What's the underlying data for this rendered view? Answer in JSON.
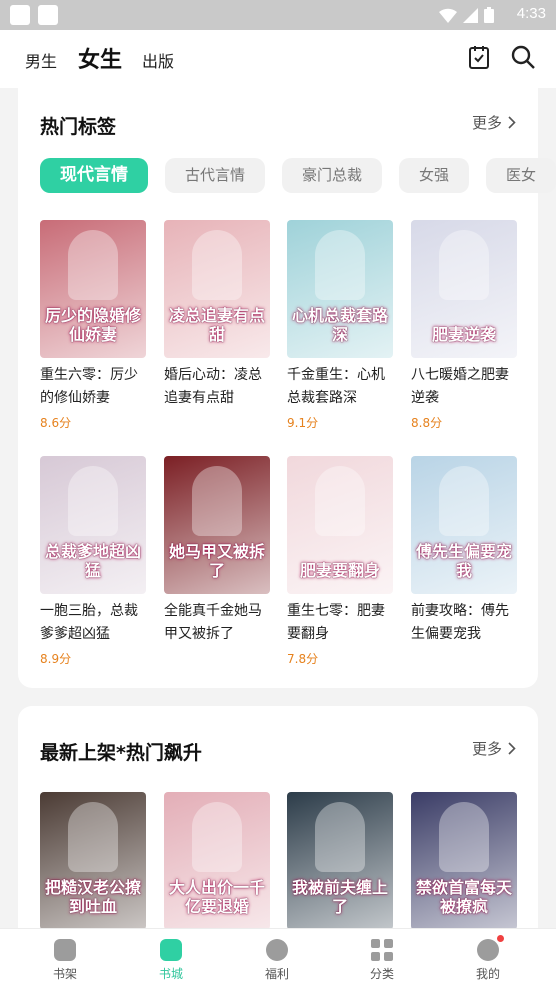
{
  "status_bar": {
    "time": "4:33"
  },
  "header": {
    "tabs": [
      {
        "label": "男生"
      },
      {
        "label": "女生"
      },
      {
        "label": "出版"
      }
    ],
    "icons": [
      "calendar-check-icon",
      "search-icon"
    ]
  },
  "hot_tags": {
    "title": "热门标签",
    "more": "更多",
    "tags": [
      "现代言情",
      "古代言情",
      "豪门总裁",
      "女强",
      "医女"
    ],
    "books": [
      {
        "cover_text": "厉少的隐婚修仙娇妻",
        "title": "重生六零：厉少的修仙娇妻",
        "score": "8.6分",
        "color": "#c86c77"
      },
      {
        "cover_text": "凌总追妻有点甜",
        "title": "婚后心动：凌总追妻有点甜",
        "score": "",
        "color": "#e7b3b8"
      },
      {
        "cover_text": "心机总裁套路深",
        "title": "千金重生：心机总裁套路深",
        "score": "9.1分",
        "color": "#9fd2d9"
      },
      {
        "cover_text": "肥妻逆袭",
        "title": "八七暖婚之肥妻逆袭",
        "score": "8.8分",
        "color": "#d7d9e8"
      },
      {
        "cover_text": "总裁爹地超凶猛",
        "title": "一胞三胎，总裁爹爹超凶猛",
        "score": "8.9分",
        "color": "#d7c9d6"
      },
      {
        "cover_text": "她马甲又被拆了",
        "title": "全能真千金她马甲又被拆了",
        "score": "",
        "color": "#7b1f24"
      },
      {
        "cover_text": "肥妻要翻身",
        "title": "重生七零：肥妻要翻身",
        "score": "7.8分",
        "color": "#f1d8dc"
      },
      {
        "cover_text": "傅先生偏要宠我",
        "title": "前妻攻略：傅先生偏要宠我",
        "score": "",
        "color": "#b9d4e6"
      }
    ]
  },
  "new_hot": {
    "title": "最新上架*热门飙升",
    "more": "更多",
    "books": [
      {
        "cover_text": "把糙汉老公撩到吐血",
        "color": "#4b3b34"
      },
      {
        "cover_text": "大人出价一千亿要退婚",
        "color": "#e3aeb7"
      },
      {
        "cover_text": "我被前夫缠上了",
        "color": "#2c3c49"
      },
      {
        "cover_text": "禁欲首富每天被撩疯",
        "color": "#3a3c66"
      }
    ]
  },
  "bottom_nav": [
    {
      "label": "书架",
      "icon": "bookshelf-icon"
    },
    {
      "label": "书城",
      "icon": "bookstore-icon"
    },
    {
      "label": "福利",
      "icon": "welfare-icon"
    },
    {
      "label": "分类",
      "icon": "category-icon"
    },
    {
      "label": "我的",
      "icon": "profile-icon"
    }
  ]
}
